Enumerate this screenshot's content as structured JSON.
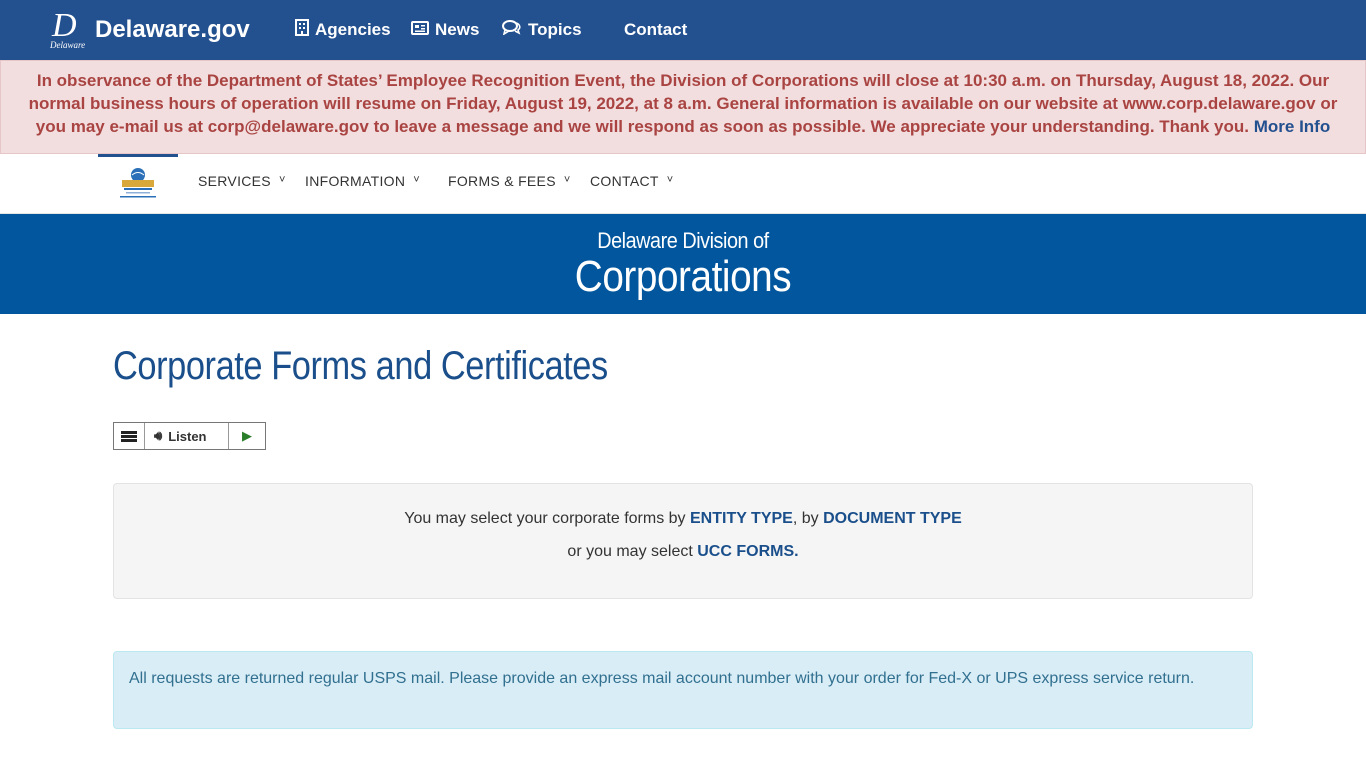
{
  "topbar": {
    "logo_letter": "D",
    "logo_sub": "Delaware",
    "site_title": "Delaware.gov",
    "nav": [
      {
        "label": "Agencies",
        "icon": "building-icon"
      },
      {
        "label": "News",
        "icon": "newspaper-icon"
      },
      {
        "label": "Topics",
        "icon": "chat-bubbles-icon"
      },
      {
        "label": "Contact",
        "icon": ""
      }
    ]
  },
  "alert": {
    "message": "In observance of the Department of States’ Employee Recognition Event, the Division of Corporations will close at 10:30 a.m. on Thursday, August 18, 2022. Our normal business hours of operation will resume on Friday, August 19, 2022, at 8 a.m. General information is available on our website at www.corp.delaware.gov or you may e-mail us at corp@delaware.gov to leave a message and we will respond as soon as possible. We appreciate your understanding. Thank you.",
    "more_link": "More Info"
  },
  "subnav": {
    "items": [
      "SERVICES",
      "INFORMATION",
      "FORMS & FEES",
      "CONTACT"
    ]
  },
  "hero": {
    "small": "Delaware Division of",
    "big": "Corporations"
  },
  "page": {
    "title": "Corporate Forms and Certificates"
  },
  "listen": {
    "label": "Listen"
  },
  "selection": {
    "line1_prefix": "You may select your corporate forms by ",
    "entity_type": "ENTITY TYPE",
    "line1_mid": ", by ",
    "document_type": "DOCUMENT TYPE",
    "line2_prefix": "or you may select ",
    "ucc_forms": "UCC FORMS."
  },
  "info": {
    "message": "All requests are returned regular USPS mail. Please provide an express mail account number with your order for Fed-X or UPS express service return."
  },
  "colors": {
    "topbar": "#23508f",
    "hero": "#02569d",
    "alert_bg": "#f2dede",
    "alert_text": "#a94442",
    "info_bg": "#d9edf7",
    "link": "#1a4f8b"
  }
}
